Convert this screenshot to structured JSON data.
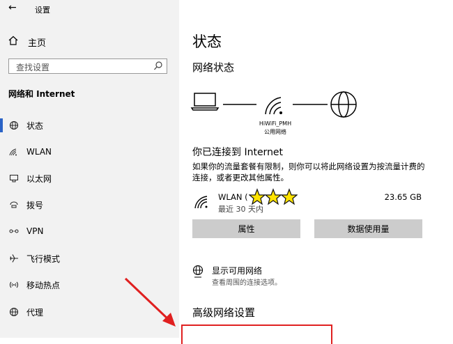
{
  "window": {
    "title": "设置",
    "back_icon": "arrow-left"
  },
  "sidebar": {
    "home_label": "主页",
    "search_placeholder": "查找设置",
    "section_title": "网络和 Internet",
    "items": [
      {
        "label": "状态",
        "icon": "status-globe-icon",
        "active": true
      },
      {
        "label": "WLAN",
        "icon": "wifi-icon"
      },
      {
        "label": "以太网",
        "icon": "ethernet-icon"
      },
      {
        "label": "拨号",
        "icon": "dialup-icon"
      },
      {
        "label": "VPN",
        "icon": "vpn-icon"
      },
      {
        "label": "飞行模式",
        "icon": "airplane-icon"
      },
      {
        "label": "移动热点",
        "icon": "hotspot-icon"
      },
      {
        "label": "代理",
        "icon": "proxy-globe-icon"
      }
    ]
  },
  "main": {
    "title": "状态",
    "network_status_title": "网络状态",
    "diagram": {
      "ssid": "HiWiFi_PMH",
      "network_type": "公用网络"
    },
    "connected_title": "你已连接到 Internet",
    "description": "如果你的流量套餐有限制，则你可以将此网络设置为按流量计费的连接，或者更改其他属性。",
    "connection": {
      "name": "WLAN (",
      "since": "最近 30 天内",
      "usage": "23.65 GB"
    },
    "buttons": {
      "properties": "属性",
      "data_usage": "数据使用量"
    },
    "show_networks": {
      "label": "显示可用网络",
      "sublabel": "查看周围的连接选项。"
    },
    "advanced_title": "高级网络设置"
  },
  "annotation": {
    "highlight_color": "#e02020"
  }
}
